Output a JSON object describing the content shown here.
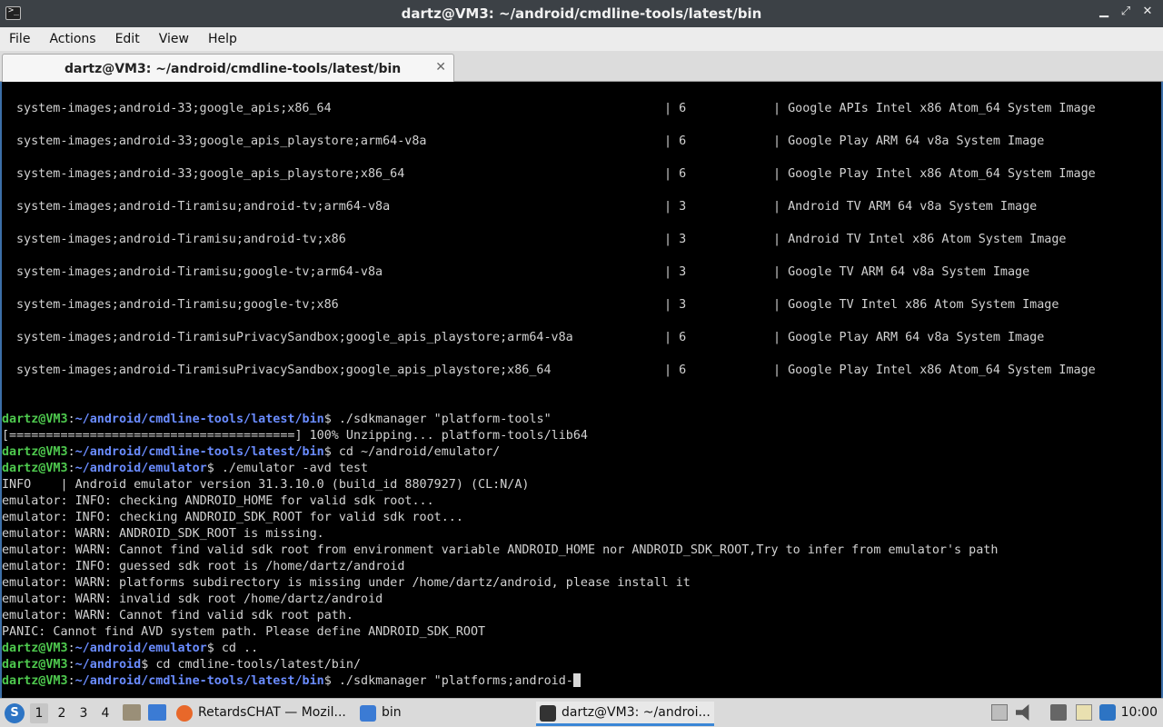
{
  "window": {
    "title": "dartz@VM3: ~/android/cmdline-tools/latest/bin",
    "app_icon_glyph": ">_",
    "minimize_glyph": "▁",
    "restore_glyph": "⤢",
    "close_glyph": "✕"
  },
  "menubar": [
    "File",
    "Actions",
    "Edit",
    "View",
    "Help"
  ],
  "tab": {
    "label": "dartz@VM3: ~/android/cmdline-tools/latest/bin",
    "close_glyph": "✕"
  },
  "terminal": {
    "packages": [
      {
        "path": "system-images;android-33;google_apis;x86_64",
        "version": "| 6",
        "description": "| Google APIs Intel x86 Atom_64 System Image"
      },
      {
        "path": "system-images;android-33;google_apis_playstore;arm64-v8a",
        "version": "| 6",
        "description": "| Google Play ARM 64 v8a System Image"
      },
      {
        "path": "system-images;android-33;google_apis_playstore;x86_64",
        "version": "| 6",
        "description": "| Google Play Intel x86 Atom_64 System Image"
      },
      {
        "path": "system-images;android-Tiramisu;android-tv;arm64-v8a",
        "version": "| 3",
        "description": "| Android TV ARM 64 v8a System Image"
      },
      {
        "path": "system-images;android-Tiramisu;android-tv;x86",
        "version": "| 3",
        "description": "| Android TV Intel x86 Atom System Image"
      },
      {
        "path": "system-images;android-Tiramisu;google-tv;arm64-v8a",
        "version": "| 3",
        "description": "| Google TV ARM 64 v8a System Image"
      },
      {
        "path": "system-images;android-Tiramisu;google-tv;x86",
        "version": "| 3",
        "description": "| Google TV Intel x86 Atom System Image"
      },
      {
        "path": "system-images;android-TiramisuPrivacySandbox;google_apis_playstore;arm64-v8a",
        "version": "| 6",
        "description": "| Google Play ARM 64 v8a System Image"
      },
      {
        "path": "system-images;android-TiramisuPrivacySandbox;google_apis_playstore;x86_64",
        "version": "| 6",
        "description": "| Google Play Intel x86 Atom_64 System Image"
      }
    ],
    "prompt_user": "dartz@VM3",
    "prompt_colon": ":",
    "prompt_sep": "$ ",
    "lines": [
      {
        "kind": "prompt",
        "path": "~/android/cmdline-tools/latest/bin",
        "cmd": "./sdkmanager \"platform-tools\""
      },
      {
        "kind": "out",
        "text": "[=======================================] 100% Unzipping... platform-tools/lib64"
      },
      {
        "kind": "prompt",
        "path": "~/android/cmdline-tools/latest/bin",
        "cmd": "cd ~/android/emulator/"
      },
      {
        "kind": "prompt",
        "path": "~/android/emulator",
        "cmd": "./emulator -avd test"
      },
      {
        "kind": "out",
        "text": "INFO    | Android emulator version 31.3.10.0 (build_id 8807927) (CL:N/A)"
      },
      {
        "kind": "out",
        "text": "emulator: INFO: checking ANDROID_HOME for valid sdk root..."
      },
      {
        "kind": "out",
        "text": "emulator: INFO: checking ANDROID_SDK_ROOT for valid sdk root..."
      },
      {
        "kind": "out",
        "text": "emulator: WARN: ANDROID_SDK_ROOT is missing."
      },
      {
        "kind": "out",
        "text": "emulator: WARN: Cannot find valid sdk root from environment variable ANDROID_HOME nor ANDROID_SDK_ROOT,Try to infer from emulator's path"
      },
      {
        "kind": "out",
        "text": "emulator: INFO: guessed sdk root is /home/dartz/android"
      },
      {
        "kind": "out",
        "text": "emulator: WARN: platforms subdirectory is missing under /home/dartz/android, please install it"
      },
      {
        "kind": "out",
        "text": "emulator: WARN: invalid sdk root /home/dartz/android"
      },
      {
        "kind": "out",
        "text": "emulator: WARN: Cannot find valid sdk root path."
      },
      {
        "kind": "out",
        "text": "PANIC: Cannot find AVD system path. Please define ANDROID_SDK_ROOT"
      },
      {
        "kind": "prompt",
        "path": "~/android/emulator",
        "cmd": "cd .."
      },
      {
        "kind": "prompt",
        "path": "~/android",
        "cmd": "cd cmdline-tools/latest/bin/"
      },
      {
        "kind": "prompt",
        "path": "~/android/cmdline-tools/latest/bin",
        "cmd": "./sdkmanager \"platforms;android-",
        "cursor": true
      }
    ]
  },
  "taskbar": {
    "start_glyph": "S",
    "workspaces": [
      "1",
      "2",
      "3",
      "4"
    ],
    "active_workspace": 0,
    "tasks": [
      {
        "label": "RetardsCHAT — Mozil...",
        "icon": "firefox-icon",
        "color": "#e8682a"
      },
      {
        "label": "bin",
        "icon": "folder-icon",
        "color": "#3b7bd4"
      },
      {
        "label": "dartz@VM3: ~/androi...",
        "icon": "terminal-icon",
        "color": "#333333",
        "active": true
      }
    ],
    "clock": "10:00"
  }
}
